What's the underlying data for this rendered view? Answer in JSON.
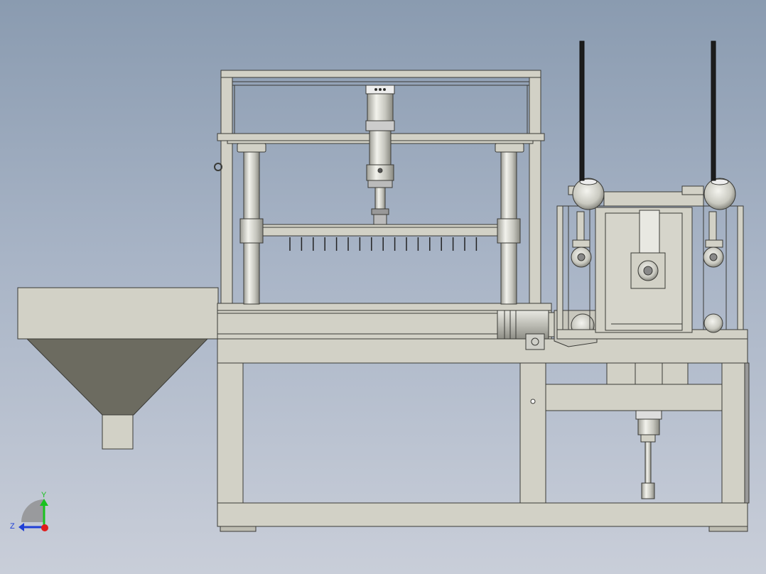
{
  "viewport": {
    "background_top": "#8a9bb0",
    "background_bottom": "#c9ced9",
    "part_fill": "#d2d1c6",
    "part_stroke": "#3a3a36",
    "hopper_fill": "#6c6b60"
  },
  "triad": {
    "y_label": "Y",
    "z_label": "Z",
    "y_color": "#19c21e",
    "z_color": "#1f3fd6",
    "x_color": "#e01b1b"
  },
  "model": {
    "description_icon": "cad-assembly-icon"
  }
}
